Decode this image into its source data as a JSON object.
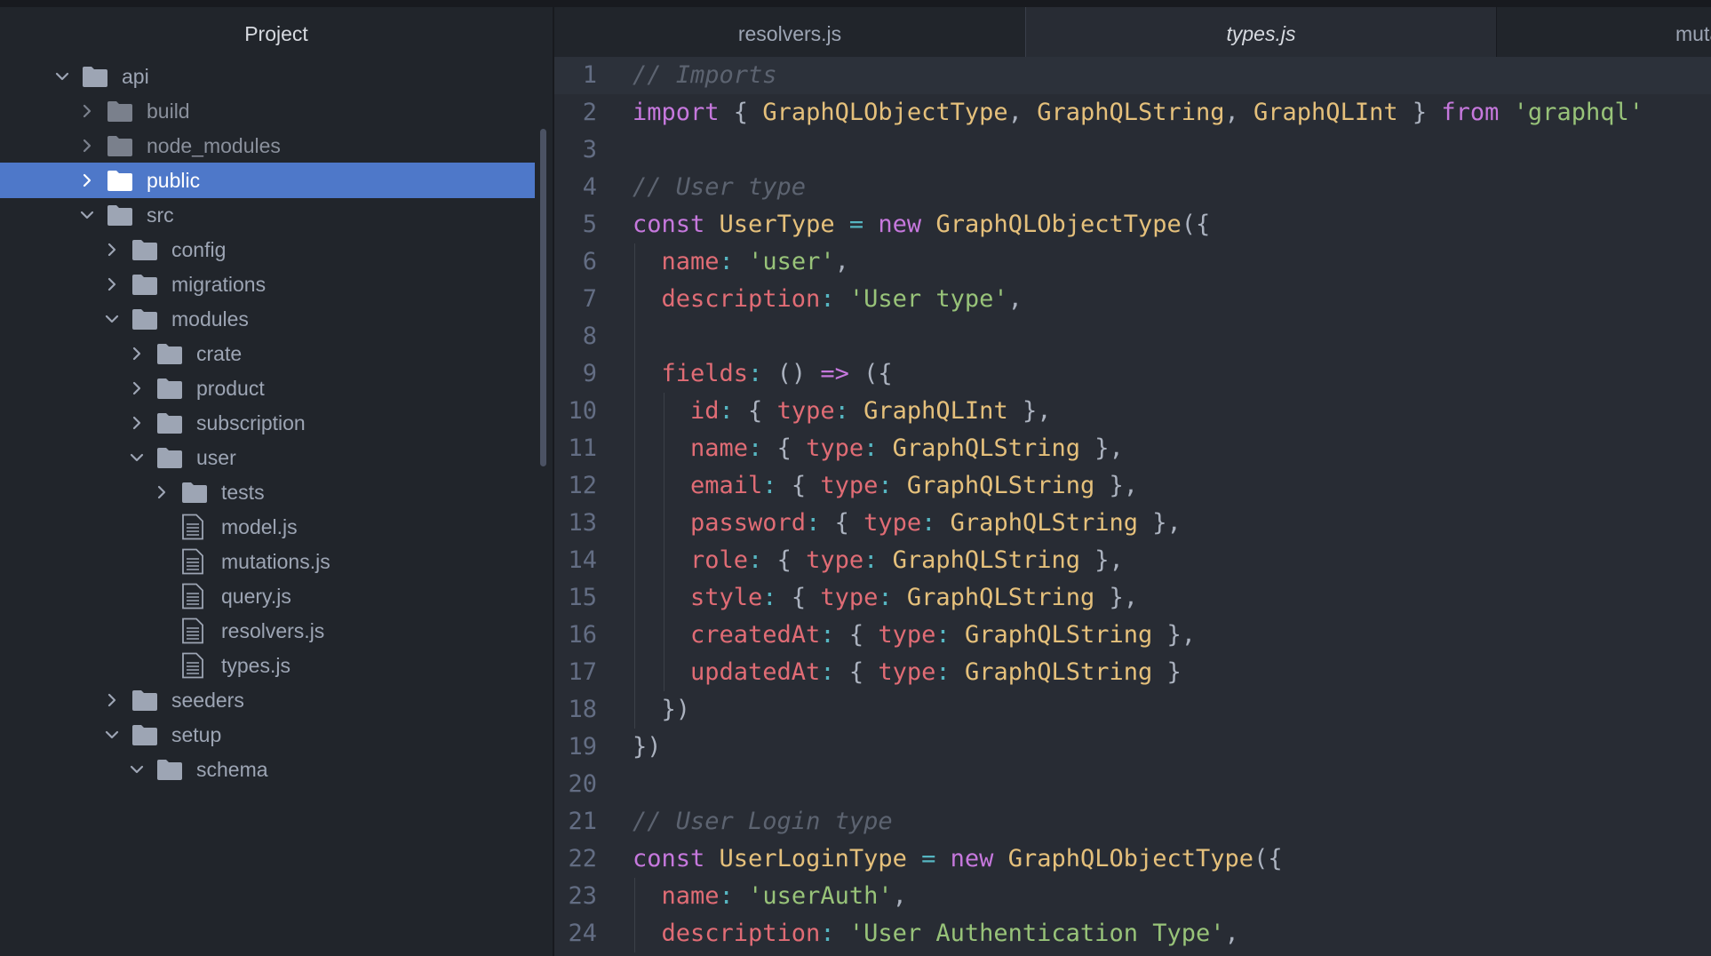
{
  "sidebar": {
    "title": "Project",
    "items": [
      {
        "label": "api",
        "type": "folder",
        "depth": 0,
        "expanded": true
      },
      {
        "label": "build",
        "type": "folder",
        "depth": 1,
        "expanded": false,
        "dim": true
      },
      {
        "label": "node_modules",
        "type": "folder",
        "depth": 1,
        "expanded": false,
        "dim": true
      },
      {
        "label": "public",
        "type": "folder",
        "depth": 1,
        "expanded": false,
        "selected": true
      },
      {
        "label": "src",
        "type": "folder",
        "depth": 1,
        "expanded": true
      },
      {
        "label": "config",
        "type": "folder",
        "depth": 2,
        "expanded": false
      },
      {
        "label": "migrations",
        "type": "folder",
        "depth": 2,
        "expanded": false
      },
      {
        "label": "modules",
        "type": "folder",
        "depth": 2,
        "expanded": true
      },
      {
        "label": "crate",
        "type": "folder",
        "depth": 3,
        "expanded": false
      },
      {
        "label": "product",
        "type": "folder",
        "depth": 3,
        "expanded": false
      },
      {
        "label": "subscription",
        "type": "folder",
        "depth": 3,
        "expanded": false
      },
      {
        "label": "user",
        "type": "folder",
        "depth": 3,
        "expanded": true
      },
      {
        "label": "tests",
        "type": "folder",
        "depth": 4,
        "expanded": false
      },
      {
        "label": "model.js",
        "type": "file",
        "depth": 4
      },
      {
        "label": "mutations.js",
        "type": "file",
        "depth": 4
      },
      {
        "label": "query.js",
        "type": "file",
        "depth": 4
      },
      {
        "label": "resolvers.js",
        "type": "file",
        "depth": 4
      },
      {
        "label": "types.js",
        "type": "file",
        "depth": 4
      },
      {
        "label": "seeders",
        "type": "folder",
        "depth": 2,
        "expanded": false
      },
      {
        "label": "setup",
        "type": "folder",
        "depth": 2,
        "expanded": true
      },
      {
        "label": "schema",
        "type": "folder",
        "depth": 3,
        "expanded": true
      }
    ]
  },
  "tabs": [
    {
      "label": "resolvers.js",
      "active": false
    },
    {
      "label": "types.js",
      "active": true
    },
    {
      "label": "muta",
      "active": false
    }
  ],
  "editor": {
    "current_line": 1,
    "lines": [
      {
        "n": "1",
        "indent": 0,
        "tokens": [
          [
            "c",
            "// Imports"
          ]
        ]
      },
      {
        "n": "2",
        "indent": 0,
        "tokens": [
          [
            "k",
            "import"
          ],
          [
            "d",
            " { "
          ],
          [
            "t",
            "GraphQLObjectType"
          ],
          [
            "d",
            ", "
          ],
          [
            "t",
            "GraphQLString"
          ],
          [
            "d",
            ", "
          ],
          [
            "t",
            "GraphQLInt"
          ],
          [
            "d",
            " } "
          ],
          [
            "k",
            "from"
          ],
          [
            "d",
            " "
          ],
          [
            "s",
            "'graphql'"
          ]
        ]
      },
      {
        "n": "3",
        "indent": 0,
        "tokens": []
      },
      {
        "n": "4",
        "indent": 0,
        "tokens": [
          [
            "c",
            "// User type"
          ]
        ]
      },
      {
        "n": "5",
        "indent": 0,
        "tokens": [
          [
            "k",
            "const"
          ],
          [
            "d",
            " "
          ],
          [
            "t",
            "UserType"
          ],
          [
            "d",
            " "
          ],
          [
            "o",
            "="
          ],
          [
            "d",
            " "
          ],
          [
            "k",
            "new"
          ],
          [
            "d",
            " "
          ],
          [
            "t",
            "GraphQLObjectType"
          ],
          [
            "d",
            "({"
          ]
        ]
      },
      {
        "n": "6",
        "indent": 1,
        "tokens": [
          [
            "p",
            "name"
          ],
          [
            "o",
            ":"
          ],
          [
            "d",
            " "
          ],
          [
            "s",
            "'user'"
          ],
          [
            "d",
            ","
          ]
        ]
      },
      {
        "n": "7",
        "indent": 1,
        "tokens": [
          [
            "p",
            "description"
          ],
          [
            "o",
            ":"
          ],
          [
            "d",
            " "
          ],
          [
            "s",
            "'User type'"
          ],
          [
            "d",
            ","
          ]
        ]
      },
      {
        "n": "8",
        "indent": 1,
        "tokens": []
      },
      {
        "n": "9",
        "indent": 1,
        "tokens": [
          [
            "p",
            "fields"
          ],
          [
            "o",
            ":"
          ],
          [
            "d",
            " () "
          ],
          [
            "k",
            "=>"
          ],
          [
            "d",
            " ({"
          ]
        ]
      },
      {
        "n": "10",
        "indent": 2,
        "tokens": [
          [
            "p",
            "id"
          ],
          [
            "o",
            ":"
          ],
          [
            "d",
            " { "
          ],
          [
            "p",
            "type"
          ],
          [
            "o",
            ":"
          ],
          [
            "d",
            " "
          ],
          [
            "t",
            "GraphQLInt"
          ],
          [
            "d",
            " },"
          ]
        ]
      },
      {
        "n": "11",
        "indent": 2,
        "tokens": [
          [
            "p",
            "name"
          ],
          [
            "o",
            ":"
          ],
          [
            "d",
            " { "
          ],
          [
            "p",
            "type"
          ],
          [
            "o",
            ":"
          ],
          [
            "d",
            " "
          ],
          [
            "t",
            "GraphQLString"
          ],
          [
            "d",
            " },"
          ]
        ]
      },
      {
        "n": "12",
        "indent": 2,
        "tokens": [
          [
            "p",
            "email"
          ],
          [
            "o",
            ":"
          ],
          [
            "d",
            " { "
          ],
          [
            "p",
            "type"
          ],
          [
            "o",
            ":"
          ],
          [
            "d",
            " "
          ],
          [
            "t",
            "GraphQLString"
          ],
          [
            "d",
            " },"
          ]
        ]
      },
      {
        "n": "13",
        "indent": 2,
        "tokens": [
          [
            "p",
            "password"
          ],
          [
            "o",
            ":"
          ],
          [
            "d",
            " { "
          ],
          [
            "p",
            "type"
          ],
          [
            "o",
            ":"
          ],
          [
            "d",
            " "
          ],
          [
            "t",
            "GraphQLString"
          ],
          [
            "d",
            " },"
          ]
        ]
      },
      {
        "n": "14",
        "indent": 2,
        "tokens": [
          [
            "p",
            "role"
          ],
          [
            "o",
            ":"
          ],
          [
            "d",
            " { "
          ],
          [
            "p",
            "type"
          ],
          [
            "o",
            ":"
          ],
          [
            "d",
            " "
          ],
          [
            "t",
            "GraphQLString"
          ],
          [
            "d",
            " },"
          ]
        ]
      },
      {
        "n": "15",
        "indent": 2,
        "tokens": [
          [
            "p",
            "style"
          ],
          [
            "o",
            ":"
          ],
          [
            "d",
            " { "
          ],
          [
            "p",
            "type"
          ],
          [
            "o",
            ":"
          ],
          [
            "d",
            " "
          ],
          [
            "t",
            "GraphQLString"
          ],
          [
            "d",
            " },"
          ]
        ]
      },
      {
        "n": "16",
        "indent": 2,
        "tokens": [
          [
            "p",
            "createdAt"
          ],
          [
            "o",
            ":"
          ],
          [
            "d",
            " { "
          ],
          [
            "p",
            "type"
          ],
          [
            "o",
            ":"
          ],
          [
            "d",
            " "
          ],
          [
            "t",
            "GraphQLString"
          ],
          [
            "d",
            " },"
          ]
        ]
      },
      {
        "n": "17",
        "indent": 2,
        "tokens": [
          [
            "p",
            "updatedAt"
          ],
          [
            "o",
            ":"
          ],
          [
            "d",
            " { "
          ],
          [
            "p",
            "type"
          ],
          [
            "o",
            ":"
          ],
          [
            "d",
            " "
          ],
          [
            "t",
            "GraphQLString"
          ],
          [
            "d",
            " }"
          ]
        ]
      },
      {
        "n": "18",
        "indent": 1,
        "tokens": [
          [
            "d",
            "})"
          ]
        ]
      },
      {
        "n": "19",
        "indent": 0,
        "tokens": [
          [
            "d",
            "})"
          ]
        ]
      },
      {
        "n": "20",
        "indent": 0,
        "tokens": []
      },
      {
        "n": "21",
        "indent": 0,
        "tokens": [
          [
            "c",
            "// User Login type"
          ]
        ]
      },
      {
        "n": "22",
        "indent": 0,
        "tokens": [
          [
            "k",
            "const"
          ],
          [
            "d",
            " "
          ],
          [
            "t",
            "UserLoginType"
          ],
          [
            "d",
            " "
          ],
          [
            "o",
            "="
          ],
          [
            "d",
            " "
          ],
          [
            "k",
            "new"
          ],
          [
            "d",
            " "
          ],
          [
            "t",
            "GraphQLObjectType"
          ],
          [
            "d",
            "({"
          ]
        ]
      },
      {
        "n": "23",
        "indent": 1,
        "tokens": [
          [
            "p",
            "name"
          ],
          [
            "o",
            ":"
          ],
          [
            "d",
            " "
          ],
          [
            "s",
            "'userAuth'"
          ],
          [
            "d",
            ","
          ]
        ]
      },
      {
        "n": "24",
        "indent": 1,
        "tokens": [
          [
            "p",
            "description"
          ],
          [
            "o",
            ":"
          ],
          [
            "d",
            " "
          ],
          [
            "s",
            "'User Authentication Type'"
          ],
          [
            "d",
            ","
          ]
        ]
      }
    ]
  },
  "colors": {
    "selection": "#4e78c9",
    "keyword": "#c678dd",
    "string": "#98c379",
    "comment": "#5c6370",
    "type": "#e5c07b",
    "property": "#e06c75",
    "operator": "#56b6c2"
  }
}
